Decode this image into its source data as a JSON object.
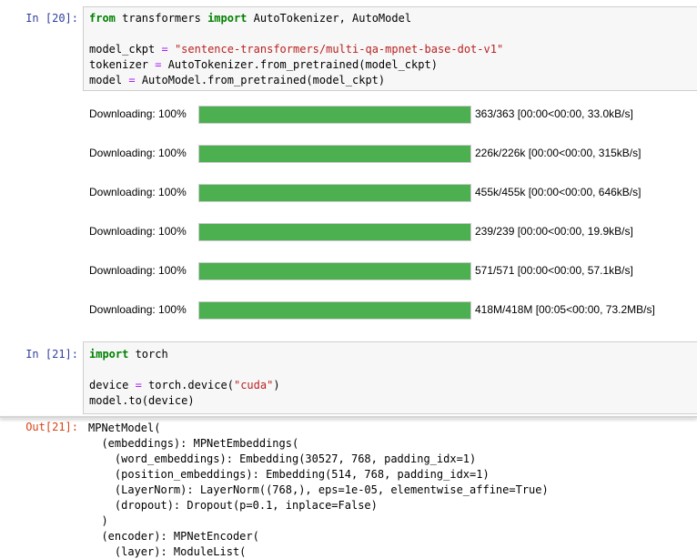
{
  "cell20": {
    "prompt": "In [20]:",
    "lines": [
      [
        {
          "t": "from",
          "c": "kw"
        },
        {
          "t": " transformers "
        },
        {
          "t": "import",
          "c": "kw"
        },
        {
          "t": " AutoTokenizer, AutoModel"
        }
      ],
      [],
      [
        {
          "t": "model_ckpt "
        },
        {
          "t": "=",
          "c": "op"
        },
        {
          "t": " "
        },
        {
          "t": "\"sentence-transformers/multi-qa-mpnet-base-dot-v1\"",
          "c": "str"
        }
      ],
      [
        {
          "t": "tokenizer "
        },
        {
          "t": "=",
          "c": "op"
        },
        {
          "t": " AutoTokenizer.from_pretrained(model_ckpt)"
        }
      ],
      [
        {
          "t": "model "
        },
        {
          "t": "=",
          "c": "op"
        },
        {
          "t": " AutoModel.from_pretrained(model_ckpt)"
        }
      ]
    ]
  },
  "downloads": [
    {
      "label": "Downloading: 100%",
      "info": "363/363 [00:00<00:00, 33.0kB/s]",
      "progress": 1.0
    },
    {
      "label": "Downloading: 100%",
      "info": "226k/226k [00:00<00:00, 315kB/s]",
      "progress": 1.0
    },
    {
      "label": "Downloading: 100%",
      "info": "455k/455k [00:00<00:00, 646kB/s]",
      "progress": 1.0
    },
    {
      "label": "Downloading: 100%",
      "info": "239/239 [00:00<00:00, 19.9kB/s]",
      "progress": 1.0
    },
    {
      "label": "Downloading: 100%",
      "info": "571/571 [00:00<00:00, 57.1kB/s]",
      "progress": 1.0
    },
    {
      "label": "Downloading: 100%",
      "info": "418M/418M [00:05<00:00, 73.2MB/s]",
      "progress": 1.0
    }
  ],
  "colors": {
    "progress_fill": "#4caf50",
    "in_prompt": "#303f9f",
    "out_prompt": "#d84315"
  },
  "cell21": {
    "prompt": "In [21]:",
    "lines": [
      [
        {
          "t": "import",
          "c": "kw"
        },
        {
          "t": " torch"
        }
      ],
      [],
      [
        {
          "t": "device "
        },
        {
          "t": "=",
          "c": "op"
        },
        {
          "t": " torch.device("
        },
        {
          "t": "\"cuda\"",
          "c": "str"
        },
        {
          "t": ")"
        }
      ],
      [
        {
          "t": "model.to(device)"
        }
      ]
    ]
  },
  "out21": {
    "prompt": "Out[21]:",
    "lines": [
      "MPNetModel(",
      "  (embeddings): MPNetEmbeddings(",
      "    (word_embeddings): Embedding(30527, 768, padding_idx=1)",
      "    (position_embeddings): Embedding(514, 768, padding_idx=1)",
      "    (LayerNorm): LayerNorm((768,), eps=1e-05, elementwise_affine=True)",
      "    (dropout): Dropout(p=0.1, inplace=False)",
      "  )",
      "  (encoder): MPNetEncoder(",
      "    (layer): ModuleList("
    ]
  }
}
